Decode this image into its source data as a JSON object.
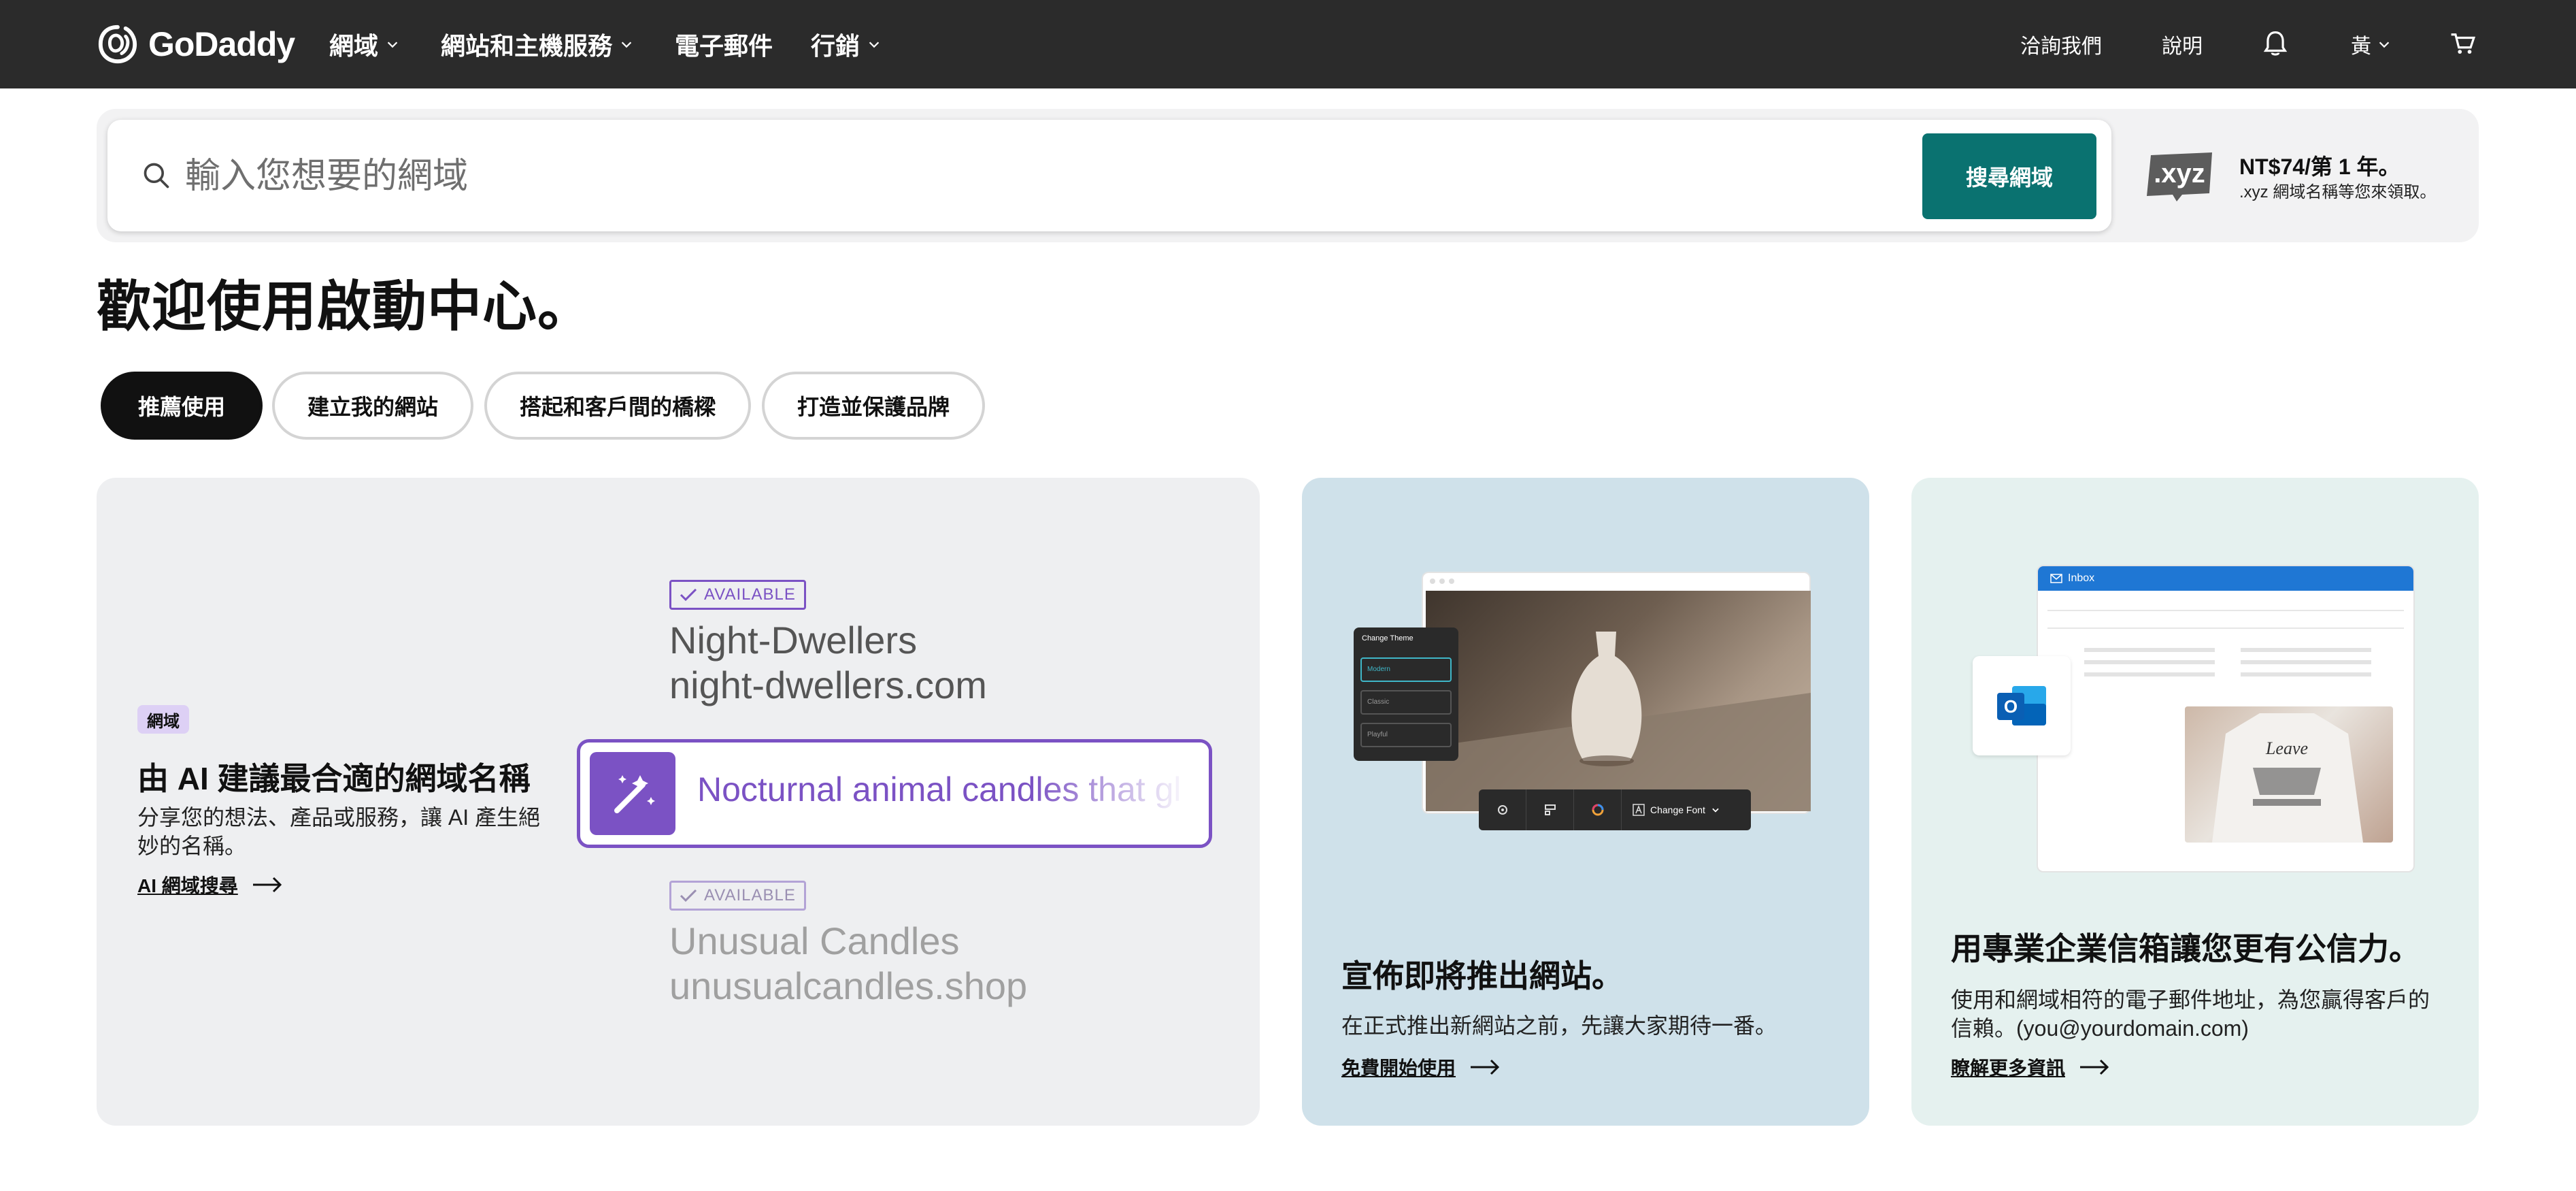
{
  "nav": {
    "brand": "GoDaddy",
    "items": [
      {
        "label": "網域"
      },
      {
        "label": "網站和主機服務"
      },
      {
        "label": "電子郵件"
      },
      {
        "label": "行銷"
      }
    ],
    "contact": "洽詢我們",
    "help": "說明",
    "user": "黃"
  },
  "search": {
    "placeholder": "輸入您想要的網域",
    "button": "搜尋網域"
  },
  "promo": {
    "badge": ".xyz",
    "title": "NT$74/第 1 年。",
    "subtitle": ".xyz 網域名稱等您來領取。"
  },
  "page": {
    "title": "歡迎使用啟動中心。"
  },
  "tabs": [
    {
      "label": "推薦使用",
      "active": true
    },
    {
      "label": "建立我的網站",
      "active": false
    },
    {
      "label": "搭起和客戶間的橋樑",
      "active": false
    },
    {
      "label": "打造並保護品牌",
      "active": false
    }
  ],
  "cards": {
    "ai": {
      "tag": "網域",
      "title": "由 AI 建議最合適的網域名稱",
      "desc": "分享您的想法、產品或服務，讓 AI 產生絕妙的名稱。",
      "link": "AI 網域搜尋",
      "available": "AVAILABLE",
      "example1_name": "Night-Dwellers",
      "example1_domain": "night-dwellers.com",
      "prompt": "Nocturnal animal candles that gl",
      "example2_name": "Unusual Candles",
      "example2_domain": "unusualcandles.shop"
    },
    "website": {
      "title": "宣佈即將推出網站。",
      "desc": "在正式推出新網站之前，先讓大家期待一番。",
      "link": "免費開始使用",
      "theme_panel_title": "Change Theme",
      "themes": [
        "Modern",
        "Classic",
        "Playful"
      ],
      "change_font": "Change Font"
    },
    "email": {
      "title": "用專業企業信箱讓您更有公信力。",
      "desc": "使用和網域相符的電子郵件地址，為您贏得客戶的信賴。(you@yourdomain.com)",
      "link": "瞭解更多資訊",
      "inbox_label": "Inbox"
    }
  },
  "colors": {
    "nav_bg": "#2b2b2b",
    "search_button": "#0a7270",
    "ai_purple": "#7b52c4",
    "card1_bg": "#eeeff1",
    "card2_bg": "#cfe1ea",
    "card3_bg": "#e5f1ef"
  }
}
